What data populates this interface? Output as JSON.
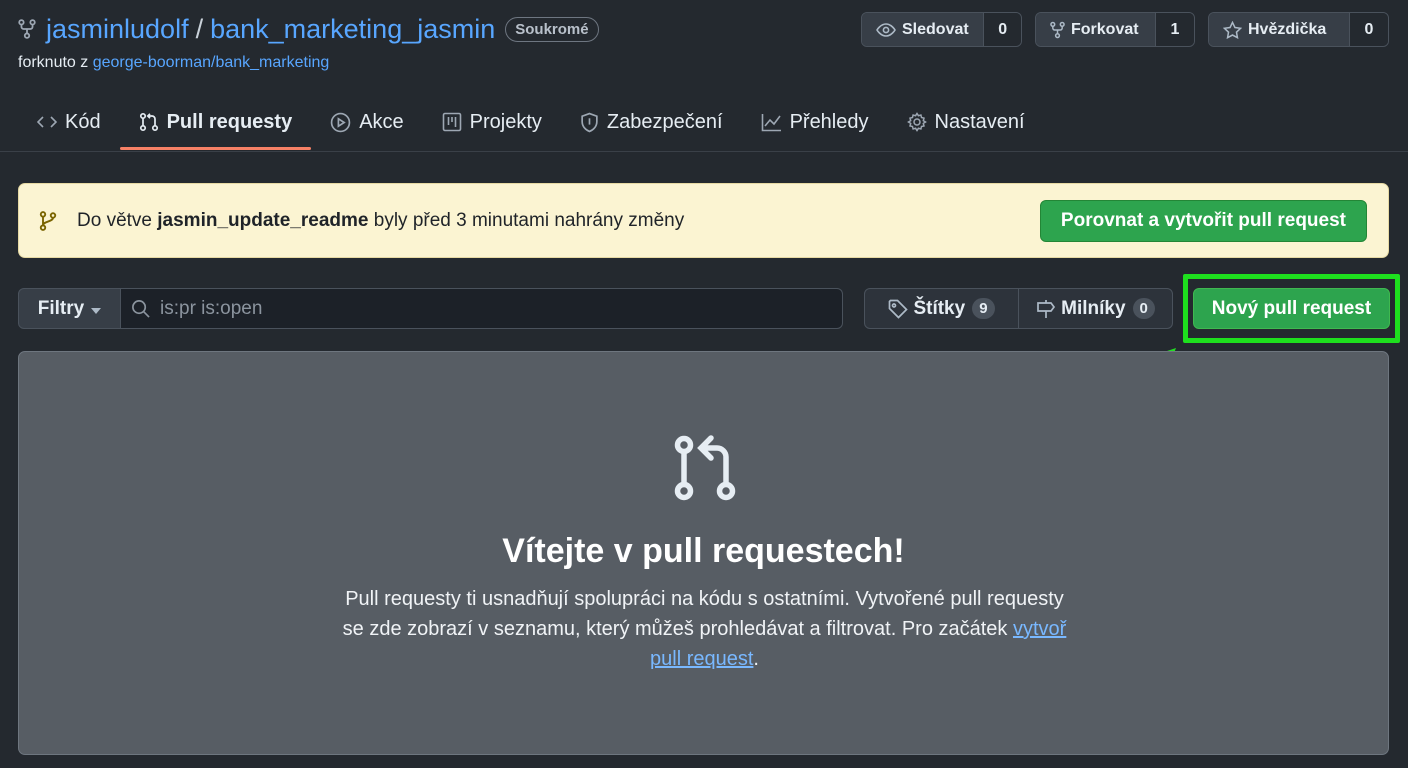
{
  "repo": {
    "owner": "jasminludolf",
    "separator": "/",
    "name": "bank_marketing_jasmin",
    "visibility": "Soukromé",
    "fork_prefix": "forknuto z",
    "fork_source": "george-boorman/bank_marketing"
  },
  "actions": {
    "watch": {
      "label": "Sledovat",
      "count": "0"
    },
    "fork": {
      "label": "Forkovat",
      "count": "1"
    },
    "star": {
      "label": "Hvězdička",
      "count": "0"
    }
  },
  "tabs": [
    {
      "label": "Kód",
      "icon": "code-icon",
      "active": false
    },
    {
      "label": "Pull requesty",
      "icon": "git-pull-request-icon",
      "active": true
    },
    {
      "label": "Akce",
      "icon": "play-icon",
      "active": false
    },
    {
      "label": "Projekty",
      "icon": "table-icon",
      "active": false
    },
    {
      "label": "Zabezpečení",
      "icon": "shield-icon",
      "active": false
    },
    {
      "label": "Přehledy",
      "icon": "graph-icon",
      "active": false
    },
    {
      "label": "Nastavení",
      "icon": "gear-icon",
      "active": false
    }
  ],
  "banner": {
    "prefix": "Do větve ",
    "branch": "jasmin_update_readme",
    "suffix": " byly před 3 minutami nahrány změny",
    "button": "Porovnat a vytvořit pull request"
  },
  "filters": {
    "button": "Filtry",
    "search_placeholder": "is:pr is:open",
    "labels": {
      "label": "Štítky",
      "count": "9"
    },
    "milestones": {
      "label": "Milníky",
      "count": "0"
    },
    "new_pr": "Nový pull request"
  },
  "blankslate": {
    "title": "Vítejte v pull requestech!",
    "desc_before": "Pull requesty ti usnadňují spolupráci na kódu s ostatními. Vytvořené pull requesty se zde zobrazí v seznamu, který můžeš prohledávat a filtrovat. Pro začátek ",
    "link": "vytvoř pull request",
    "desc_after": "."
  },
  "colors": {
    "link": "#58a6ff",
    "primary_button": "#2da44e",
    "highlight": "#1ee01e",
    "active_tab_underline": "#f78166",
    "banner_bg": "#fbf4d2"
  }
}
